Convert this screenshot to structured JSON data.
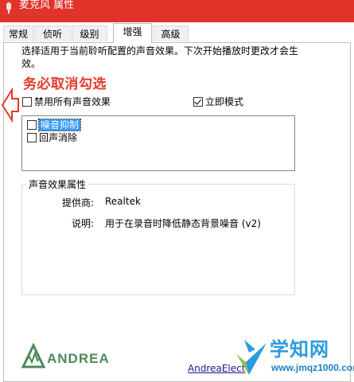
{
  "window": {
    "title": "麦克风 属性"
  },
  "tabs": [
    {
      "label": "常规",
      "active": false
    },
    {
      "label": "侦听",
      "active": false
    },
    {
      "label": "级别",
      "active": false
    },
    {
      "label": "增强",
      "active": true
    },
    {
      "label": "高级",
      "active": false
    }
  ],
  "enhancements": {
    "description": "选择适用于当前聆听配置的声音效果。下次开始播放时更改才会生效。",
    "annotation": "务必取消勾选",
    "disable_all": {
      "label": "禁用所有声音效果",
      "checked": false
    },
    "immediate_mode": {
      "label": "立即模式",
      "checked": true
    },
    "effects": [
      {
        "label": "噪音抑制",
        "checked": false,
        "selected": true
      },
      {
        "label": "回声消除",
        "checked": false,
        "selected": false
      }
    ]
  },
  "properties": {
    "group_title": "声音效果属性",
    "provider_label": "提供商:",
    "provider_value": "Realtek",
    "description_label": "说明:",
    "description_value": "用于在录音时降低静态背景噪音 (v2)"
  },
  "footer": {
    "logo_text": "ANDREA",
    "link_text": "AndreaElect"
  },
  "watermark": {
    "main": "学知网",
    "sub": "www.jmqz1000.com"
  },
  "colors": {
    "titlebar": "#e0342b",
    "annotation": "#e23a2c",
    "selection": "#3399ff",
    "logo_green": "#4d8a5a",
    "watermark_blue": "#2b9be0"
  }
}
